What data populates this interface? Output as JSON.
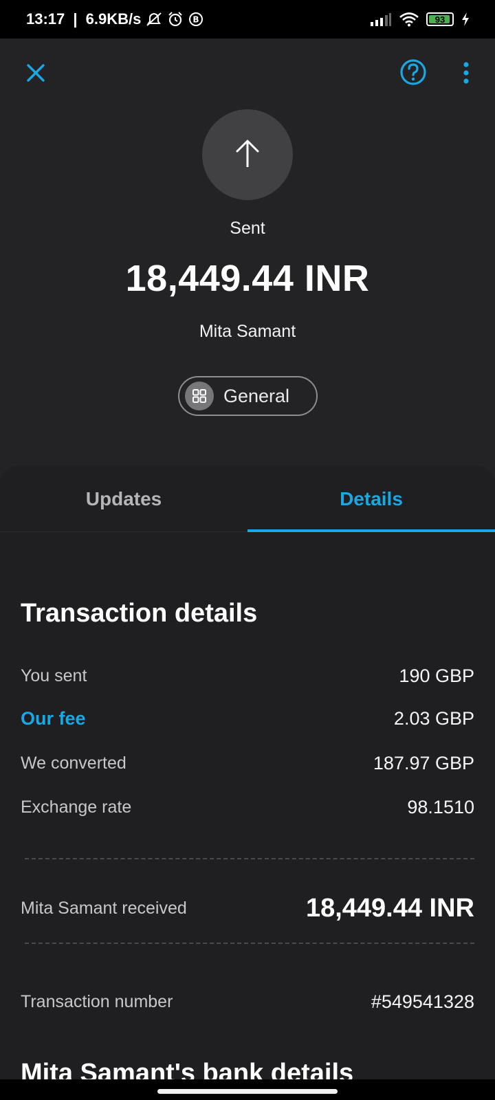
{
  "status_bar": {
    "time": "13:17",
    "network_speed": "6.9KB/s",
    "battery": "93",
    "icons": [
      "mute-icon",
      "alarm-icon",
      "b-badge-icon",
      "signal-icon",
      "wifi-icon",
      "battery-icon",
      "charging-icon"
    ]
  },
  "header": {
    "close_icon": "close-icon",
    "help_icon": "help-icon",
    "more_icon": "more-vert-icon",
    "accent_color": "#18a8e4"
  },
  "transfer": {
    "direction_icon": "arrow-up-icon",
    "status": "Sent",
    "amount": "18,449.44 INR",
    "recipient": "Mita Samant",
    "category": "General",
    "category_icon": "grid-icon"
  },
  "tabs": [
    {
      "label": "Updates",
      "active": false
    },
    {
      "label": "Details",
      "active": true
    }
  ],
  "details": {
    "title": "Transaction details",
    "rows": [
      {
        "label": "You sent",
        "value": "190 GBP"
      },
      {
        "label": "Our fee",
        "value": "2.03 GBP"
      },
      {
        "label": "We converted",
        "value": "187.97 GBP"
      },
      {
        "label": "Exchange rate",
        "value": "98.1510"
      }
    ],
    "received": {
      "label": "Mita Samant received",
      "value": "18,449.44 INR"
    },
    "transaction_number": {
      "label": "Transaction number",
      "value": "#549541328"
    }
  },
  "bank_details": {
    "title": "Mita Samant's bank details"
  }
}
